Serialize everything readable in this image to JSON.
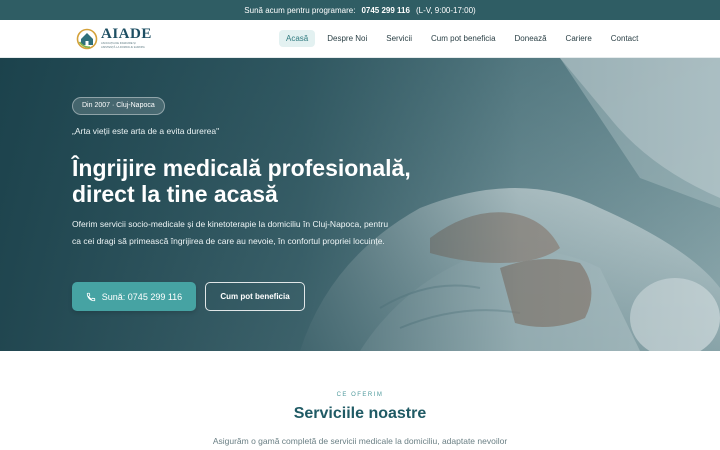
{
  "topbar": {
    "text": "Sună acum pentru programare:",
    "phone": "0745 299 116",
    "hours": "(L-V, 9:00-17:00)"
  },
  "logo": {
    "name": "AIADE",
    "tagline": "ASOCIAȚIA DE INGRIJIRE ȘI ASISTENȚĂ LA DOMICILIU EUROPA"
  },
  "nav": {
    "items": [
      {
        "label": "Acasă",
        "active": true
      },
      {
        "label": "Despre Noi",
        "active": false
      },
      {
        "label": "Servicii",
        "active": false
      },
      {
        "label": "Cum pot beneficia",
        "active": false
      },
      {
        "label": "Donează",
        "active": false
      },
      {
        "label": "Cariere",
        "active": false
      },
      {
        "label": "Contact",
        "active": false
      }
    ]
  },
  "hero": {
    "badge": "Din 2007 · Cluj-Napoca",
    "quote": "„Arta vieții este arta de a evita durerea\"",
    "title_line1": "Îngrijire medicală profesională,",
    "title_line2": "direct la tine acasă",
    "description": "Oferim servicii socio-medicale și de kinetoterapie la domiciliu în Cluj-Napoca, pentru ca cei dragi să primească îngrijirea de care au nevoie, în confortul propriei locuințe.",
    "call_button": "Sună: 0745 299 116",
    "call_icon": "phone-icon",
    "benefit_button": "Cum pot beneficia"
  },
  "services": {
    "kicker": "CE OFERIM",
    "title": "Serviciile noastre",
    "description": "Asigurăm o gamă completă de servicii medicale la domiciliu, adaptate nevoilor"
  },
  "colors": {
    "topbar": "#2f5d64",
    "accent": "#46a3a3",
    "active_nav_bg": "#e3f1f1",
    "heading": "#1f5a64"
  }
}
